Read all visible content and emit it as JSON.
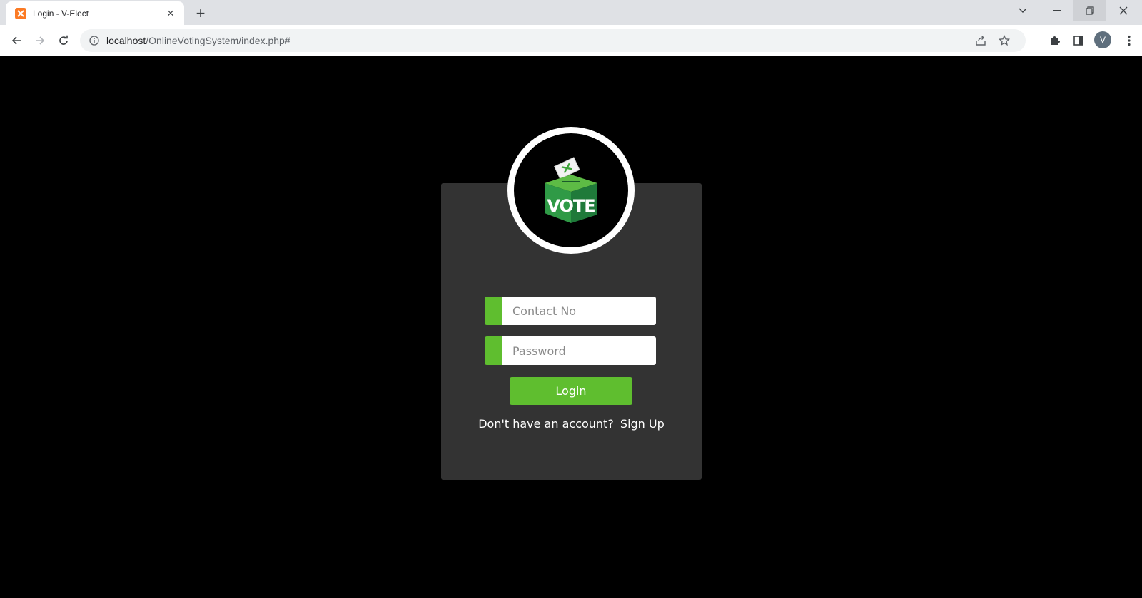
{
  "browser": {
    "tab_title": "Login - V-Elect",
    "tab_favicon": "xampp-icon",
    "url_host": "localhost",
    "url_path": "/OnlineVotingSystem/index.php#",
    "profile_initial": "V"
  },
  "login": {
    "logo_text": "VOTE",
    "logo_icon": "ballot-box-icon",
    "contact_placeholder": "Contact No",
    "password_placeholder": "Password",
    "login_label": "Login",
    "no_account_text": "Don't have an account?",
    "signup_label": "Sign Up"
  },
  "colors": {
    "accent": "#5fbe2f",
    "card_bg": "#333333",
    "page_bg": "#000000"
  }
}
